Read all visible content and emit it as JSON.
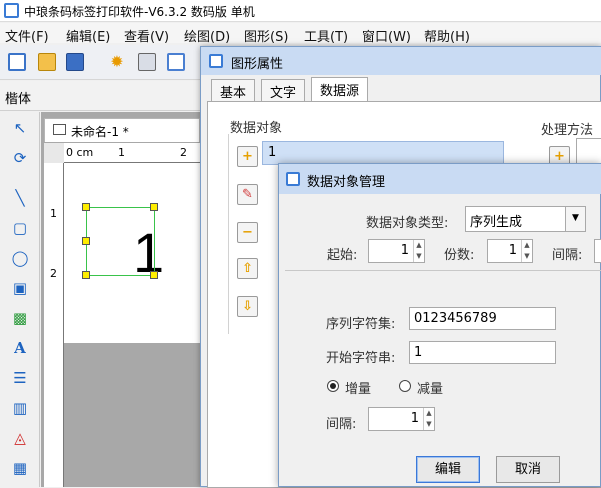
{
  "window": {
    "title": "中琅条码标签打印软件-V6.3.2 数码版 单机"
  },
  "menu": [
    "文件(F)",
    "编辑(E)",
    "查看(V)",
    "绘图(D)",
    "图形(S)",
    "工具(T)",
    "窗口(W)",
    "帮助(H)"
  ],
  "font_bar": {
    "font_name": "楷体"
  },
  "document": {
    "tab_label": "未命名-1 *",
    "ruler_unit": "0 cm",
    "ruler_marks": [
      "1",
      "2"
    ],
    "vruler_marks": [
      "1",
      "2"
    ],
    "content_text": "1"
  },
  "properties_dialog": {
    "title": "图形属性",
    "tabs": [
      "基本",
      "文字",
      "数据源"
    ],
    "active_tab": "数据源",
    "data_objects_label": "数据对象",
    "processing_label": "处理方法",
    "list_items": [
      "1"
    ]
  },
  "manager_dialog": {
    "title": "数据对象管理",
    "type_label": "数据对象类型:",
    "type_value": "序列生成",
    "start_label": "起始:",
    "start_value": "1",
    "copies_label": "份数:",
    "copies_value": "1",
    "interval_label": "间隔:",
    "charset_label": "序列字符集:",
    "charset_value": "0123456789",
    "start_string_label": "开始字符串:",
    "start_string_value": "1",
    "increment_label": "增量",
    "decrement_label": "减量",
    "increment_selected": true,
    "step_label": "间隔:",
    "step_value": "1",
    "edit_button": "编辑",
    "cancel_button": "取消"
  },
  "colors": {
    "caption": "#c9dbf3",
    "selection": "#39c34a",
    "handle": "#ffee00",
    "accent": "#3b78d8"
  }
}
